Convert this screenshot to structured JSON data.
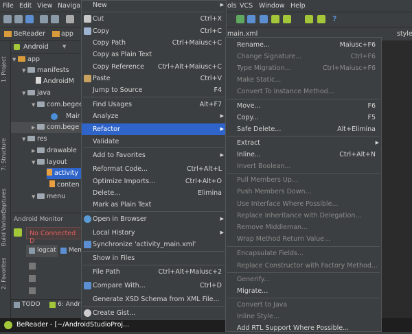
{
  "menubar": {
    "items": [
      "File",
      "Edit",
      "View",
      "Naviga",
      "ols",
      "VCS",
      "Window",
      "Help"
    ]
  },
  "navbar": {
    "crumbs": [
      "BeReader",
      "app",
      "main.xml",
      "style"
    ]
  },
  "left_strip": {
    "tabs": [
      "1: Project",
      "7: Structure",
      "Captures",
      "Build Variants",
      "2: Favorites"
    ]
  },
  "project": {
    "selector": "Android",
    "tree": [
      "app",
      "manifests",
      "AndroidM",
      "java",
      "com.begee",
      "Mair",
      "com.bege",
      "res",
      "drawable",
      "layout",
      "activity",
      "conten",
      "menu"
    ]
  },
  "monitor": {
    "title": "Android Monitor",
    "status": "No Connected D",
    "tabs": [
      "logcat",
      "Mem"
    ]
  },
  "bottom_tabs": [
    "TODO",
    "6: Andr"
  ],
  "statusbar": {
    "title": "BeReader - [~/AndroidStudioProj..."
  },
  "context_menu": {
    "items": [
      {
        "label": "New",
        "shortcut": "",
        "sub": true
      },
      {
        "label": "Cut",
        "shortcut": "Ctrl+X",
        "icon": "scissors-icon"
      },
      {
        "label": "Copy",
        "shortcut": "Ctrl+C",
        "icon": "copy-icon"
      },
      {
        "label": "Copy Path",
        "shortcut": "Ctrl+Maiusc+C"
      },
      {
        "label": "Copy as Plain Text",
        "shortcut": ""
      },
      {
        "label": "Copy Reference",
        "shortcut": "Ctrl+Alt+Maiusc+C"
      },
      {
        "label": "Paste",
        "shortcut": "Ctrl+V",
        "icon": "paste-icon"
      },
      {
        "label": "Jump to Source",
        "shortcut": "F4"
      },
      {
        "label": "Find Usages",
        "shortcut": "Alt+F7"
      },
      {
        "label": "Analyze",
        "shortcut": "",
        "sub": true
      },
      {
        "label": "Refactor",
        "shortcut": "",
        "sub": true,
        "selected": true
      },
      {
        "label": "Validate",
        "shortcut": ""
      },
      {
        "label": "Add to Favorites",
        "shortcut": "",
        "sub": true
      },
      {
        "label": "Reformat Code...",
        "shortcut": "Ctrl+Alt+L"
      },
      {
        "label": "Optimize Imports...",
        "shortcut": "Ctrl+Alt+O"
      },
      {
        "label": "Delete...",
        "shortcut": "Elimina"
      },
      {
        "label": "Mark as Plain Text",
        "shortcut": ""
      },
      {
        "label": "Open in Browser",
        "shortcut": "",
        "sub": true,
        "icon": "globe-icon"
      },
      {
        "label": "Local History",
        "shortcut": "",
        "sub": true
      },
      {
        "label": "Synchronize 'activity_main.xml'",
        "shortcut": "",
        "icon": "sync-icon"
      },
      {
        "label": "Show in Files",
        "shortcut": ""
      },
      {
        "label": "File Path",
        "shortcut": "Ctrl+Alt+Maiusc+2"
      },
      {
        "label": "Compare With...",
        "shortcut": "Ctrl+D",
        "icon": "compare-icon"
      },
      {
        "label": "Generate XSD Schema from XML File...",
        "shortcut": ""
      },
      {
        "label": "Create Gist...",
        "shortcut": "",
        "icon": "github-icon"
      }
    ]
  },
  "refactor_menu": {
    "items": [
      {
        "label": "Rename...",
        "shortcut": "Maiusc+F6"
      },
      {
        "label": "Change Signature...",
        "shortcut": "Ctrl+F6",
        "disabled": true
      },
      {
        "label": "Type Migration...",
        "shortcut": "Ctrl+Maiusc+F6",
        "disabled": true
      },
      {
        "label": "Make Static...",
        "shortcut": "",
        "disabled": true
      },
      {
        "label": "Convert To Instance Method...",
        "shortcut": "",
        "disabled": true
      },
      {
        "label": "Move...",
        "shortcut": "F6"
      },
      {
        "label": "Copy...",
        "shortcut": "F5"
      },
      {
        "label": "Safe Delete...",
        "shortcut": "Alt+Elimina"
      },
      {
        "label": "Extract",
        "shortcut": "",
        "sub": true
      },
      {
        "label": "Inline...",
        "shortcut": "Ctrl+Alt+N"
      },
      {
        "label": "Invert Boolean...",
        "shortcut": "",
        "disabled": true
      },
      {
        "label": "Pull Members Up...",
        "shortcut": "",
        "disabled": true
      },
      {
        "label": "Push Members Down...",
        "shortcut": "",
        "disabled": true
      },
      {
        "label": "Use Interface Where Possible...",
        "shortcut": "",
        "disabled": true
      },
      {
        "label": "Replace Inheritance with Delegation...",
        "shortcut": "",
        "disabled": true
      },
      {
        "label": "Remove Middleman...",
        "shortcut": "",
        "disabled": true
      },
      {
        "label": "Wrap Method Return Value...",
        "shortcut": "",
        "disabled": true
      },
      {
        "label": "Encapsulate Fields...",
        "shortcut": "",
        "disabled": true
      },
      {
        "label": "Replace Constructor with Factory Method...",
        "shortcut": "",
        "disabled": true
      },
      {
        "label": "Generify...",
        "shortcut": "",
        "disabled": true
      },
      {
        "label": "Migrate...",
        "shortcut": ""
      },
      {
        "label": "Convert to Java",
        "shortcut": "",
        "disabled": true
      },
      {
        "label": "Inline Style...",
        "shortcut": "",
        "disabled": true
      },
      {
        "label": "Add RTL Support Where Possible...",
        "shortcut": ""
      }
    ]
  },
  "colors": {
    "selection": "#2f65ca",
    "menu_bg": "#3c3f41",
    "android_green": "#a4c639"
  }
}
